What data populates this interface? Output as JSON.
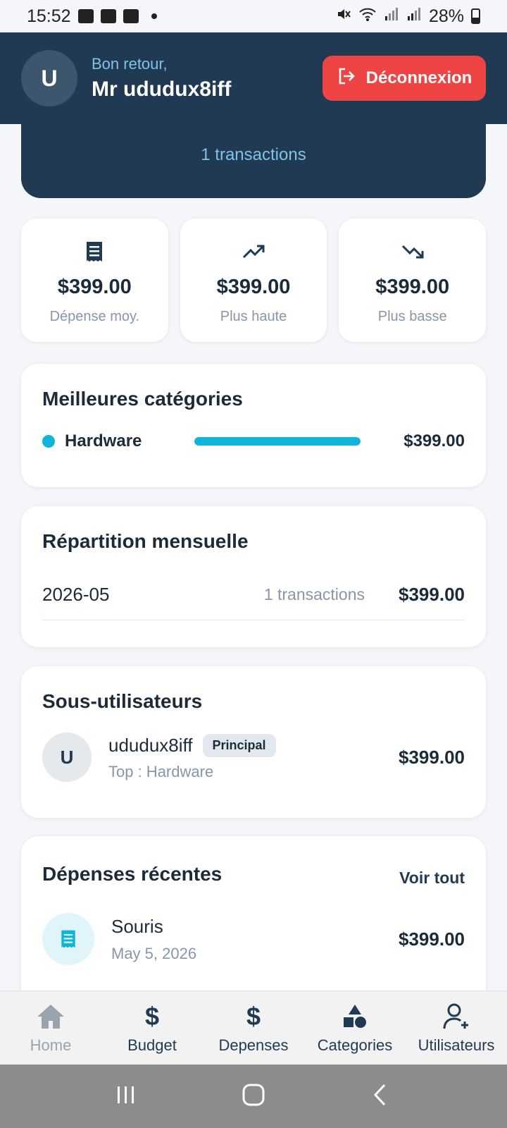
{
  "status": {
    "time": "15:52",
    "battery": "28%"
  },
  "header": {
    "avatar_initial": "U",
    "greeting": "Bon retour,",
    "user_name": "Mr ududux8iff",
    "logout_label": "Déconnexion"
  },
  "hero": {
    "transactions": "1 transactions"
  },
  "stats": [
    {
      "amount": "$399.00",
      "label": "Dépense moy.",
      "icon": "receipt-icon"
    },
    {
      "amount": "$399.00",
      "label": "Plus haute",
      "icon": "trending-up-icon"
    },
    {
      "amount": "$399.00",
      "label": "Plus basse",
      "icon": "trending-down-icon"
    }
  ],
  "top_categories": {
    "title": "Meilleures catégories",
    "items": [
      {
        "name": "Hardware",
        "amount": "$399.00",
        "share": 1.0,
        "color": "#0fb5d6"
      }
    ]
  },
  "monthly": {
    "title": "Répartition mensuelle",
    "rows": [
      {
        "month": "2026-05",
        "transactions": "1 transactions",
        "amount": "$399.00"
      }
    ]
  },
  "sub_users": {
    "title": "Sous-utilisateurs",
    "items": [
      {
        "initial": "U",
        "name": "ududux8iff",
        "badge": "Principal",
        "top": "Top : Hardware",
        "amount": "$399.00"
      }
    ]
  },
  "recent": {
    "title": "Dépenses récentes",
    "see_all": "Voir tout",
    "items": [
      {
        "title": "Souris",
        "date": "May 5, 2026",
        "amount": "$399.00"
      }
    ]
  },
  "nav": [
    {
      "label": "Home",
      "icon": "home-icon",
      "active": false
    },
    {
      "label": "Budget",
      "icon": "dollar-icon",
      "active": true
    },
    {
      "label": "Depenses",
      "icon": "dollar-icon",
      "active": true
    },
    {
      "label": "Categories",
      "icon": "shapes-icon",
      "active": true
    },
    {
      "label": "Utilisateurs",
      "icon": "user-add-icon",
      "active": true
    }
  ],
  "nav_glyphs": {
    "dollar": "$"
  },
  "colors": {
    "header": "#1f3a52",
    "logout": "#ef4444",
    "accent": "#0fb5d6"
  }
}
